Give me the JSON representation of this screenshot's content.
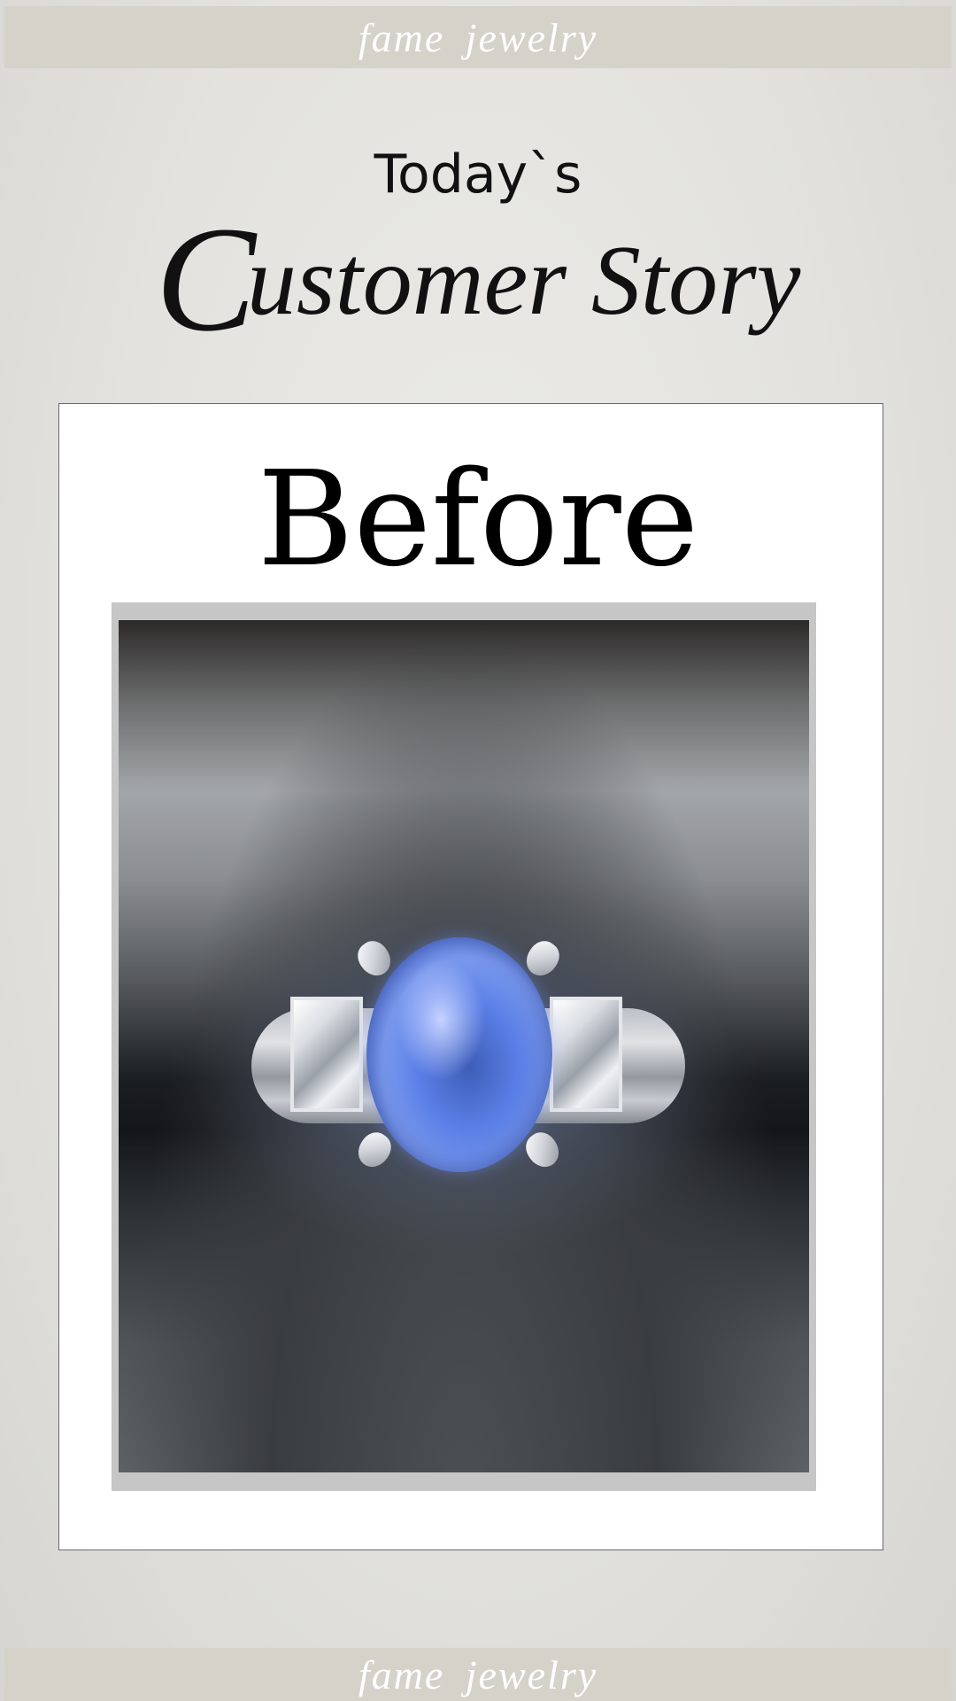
{
  "brand": {
    "top_label": "fame jewelry",
    "bottom_label": "fame jewelry",
    "color": "#d5d2ca"
  },
  "header": {
    "line1": "Today`s",
    "title_first_letter": "C",
    "title_rest": "ustomer Story"
  },
  "card": {
    "title": "Before",
    "photo": {
      "subject": "sapphire ring with baguette diamonds"
    }
  }
}
